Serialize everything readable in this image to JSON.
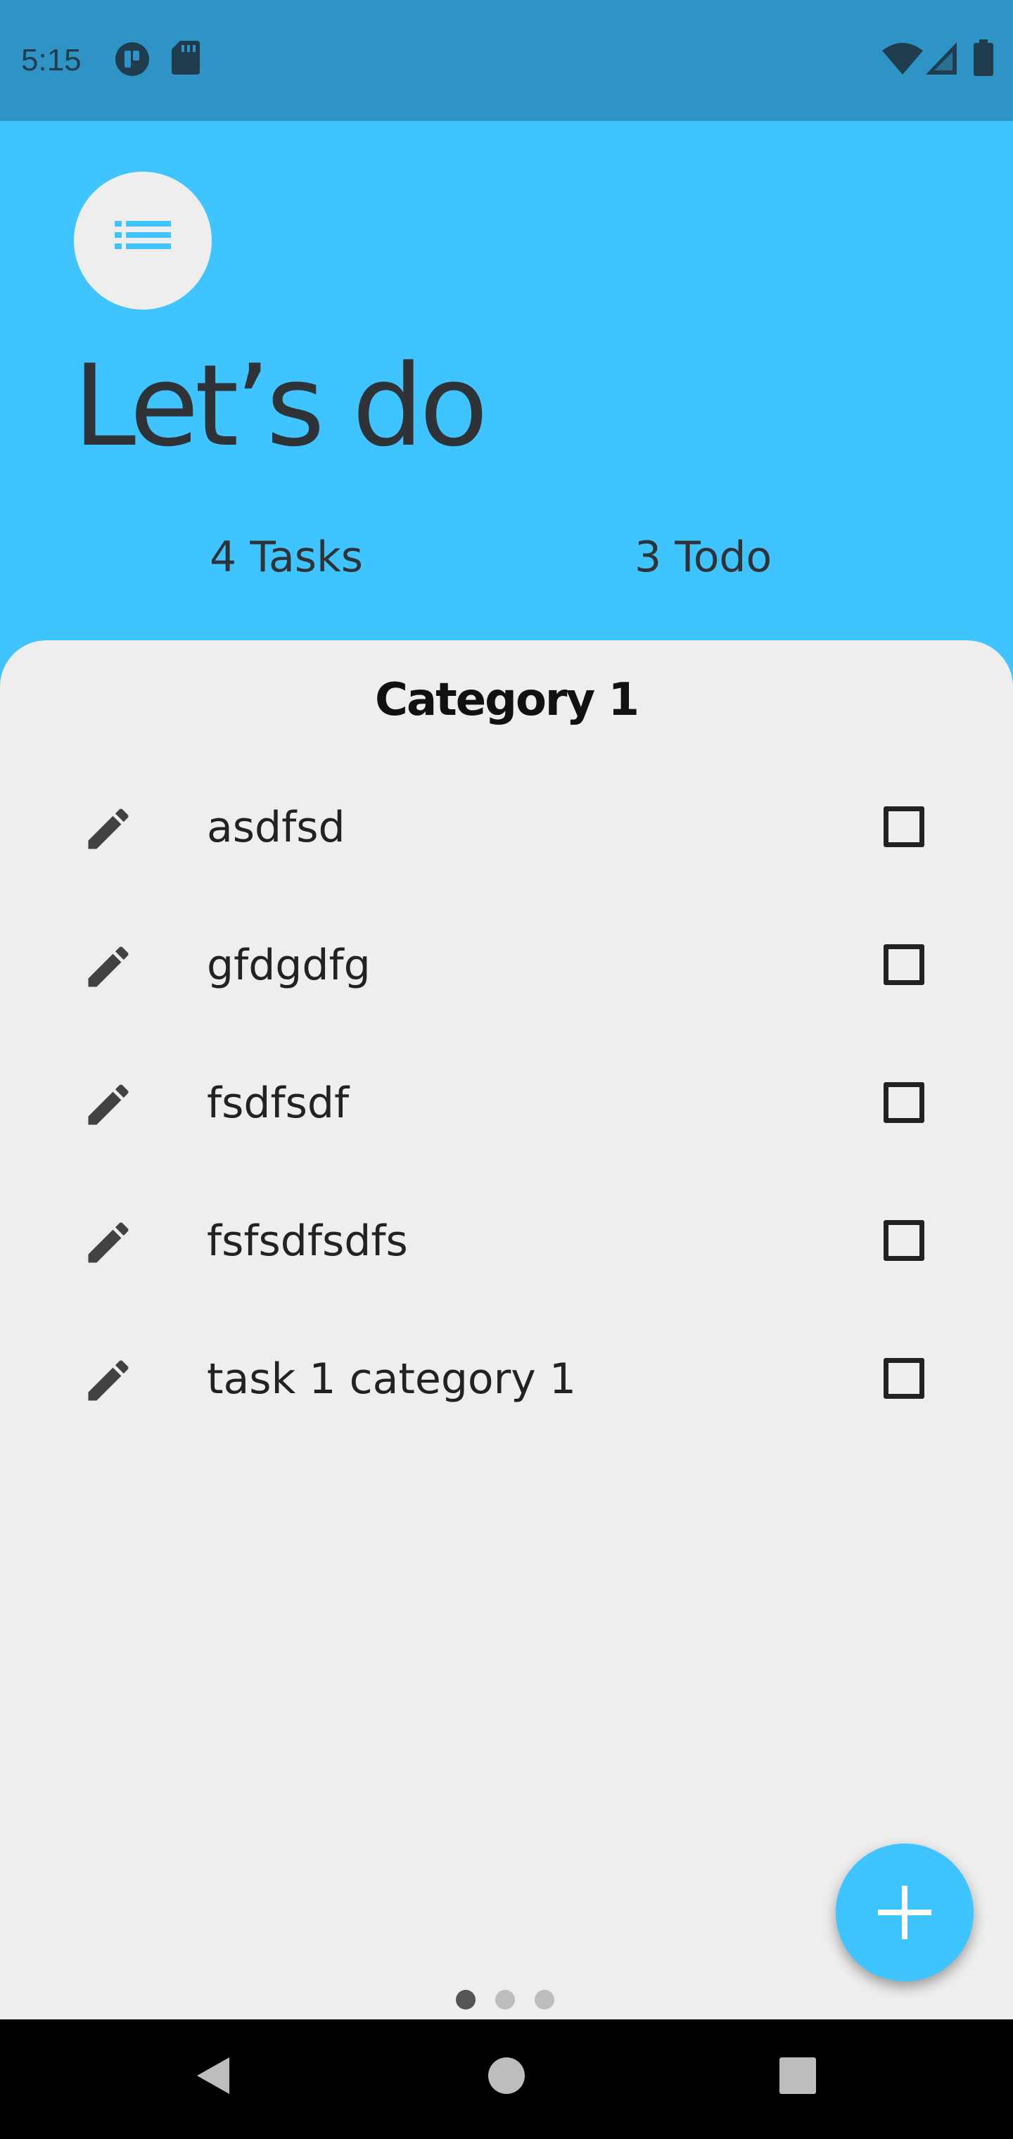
{
  "status_bar": {
    "time": "5:15",
    "left_icons": [
      "notification-app-icon",
      "sd-card-icon"
    ],
    "right_icons": [
      "wifi-icon",
      "signal-icon",
      "battery-icon"
    ]
  },
  "header": {
    "menu_icon": "list-icon",
    "title": "Let’s do",
    "tasks_count": "4 Tasks",
    "todo_count": "3 Todo"
  },
  "category": {
    "title": "Category 1",
    "tasks": [
      {
        "label": "asdfsd",
        "checked": false
      },
      {
        "label": "gfdgdfg",
        "checked": false
      },
      {
        "label": "fsdfsdf",
        "checked": false
      },
      {
        "label": "fsfsdfsdfs",
        "checked": false
      },
      {
        "label": "task 1 category 1",
        "checked": false
      }
    ]
  },
  "fab": {
    "icon": "add-icon"
  },
  "page_indicator": {
    "pages": 3,
    "active": 0
  },
  "nav_bar": {
    "buttons": [
      "back-icon",
      "home-icon",
      "recents-icon"
    ]
  },
  "colors": {
    "accent": "#40c4ff",
    "status_bar": "#3093c5",
    "sheet": "#eeeeee",
    "title_text": "#2f3338",
    "icon_dark": "#424242"
  }
}
